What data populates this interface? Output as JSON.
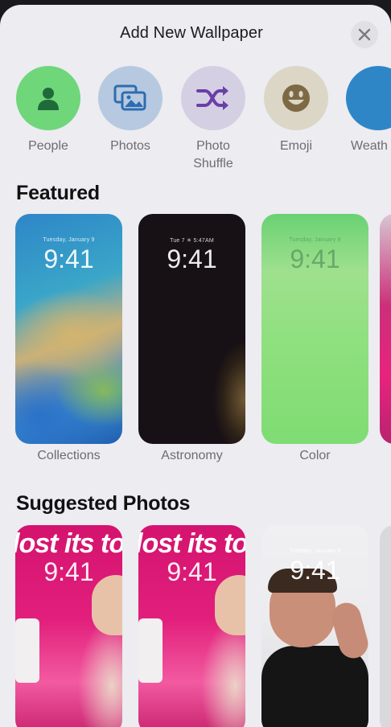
{
  "header": {
    "title": "Add New Wallpaper"
  },
  "types": [
    {
      "label": "People",
      "icon": "person-icon",
      "color": "#6fd67a"
    },
    {
      "label": "Photos",
      "icon": "photos-icon",
      "color": "#b7c9e0"
    },
    {
      "label": "Photo Shuffle",
      "icon": "shuffle-icon",
      "color": "#d5cfe3"
    },
    {
      "label": "Emoji",
      "icon": "emoji-icon",
      "color": "#dcd6c7"
    },
    {
      "label": "Weath",
      "icon": "weather-icon",
      "color": "#2f86c6"
    }
  ],
  "featured": {
    "title": "Featured",
    "cards": [
      {
        "label": "Collections",
        "date": "Tuesday, January 9",
        "time": "9:41"
      },
      {
        "label": "Astronomy",
        "date": "Tue 7  ☀ 5:47AM",
        "time": "9:41"
      },
      {
        "label": "Color",
        "date": "Tuesday, January 9",
        "time": "9:41"
      }
    ]
  },
  "suggested": {
    "title": "Suggested Photos",
    "cards": [
      {
        "banner": "lost its to",
        "time": "9:41"
      },
      {
        "banner": "lost its to",
        "time": "9:41"
      },
      {
        "date": "Tuesday, January 9",
        "time": "9:41"
      }
    ]
  }
}
